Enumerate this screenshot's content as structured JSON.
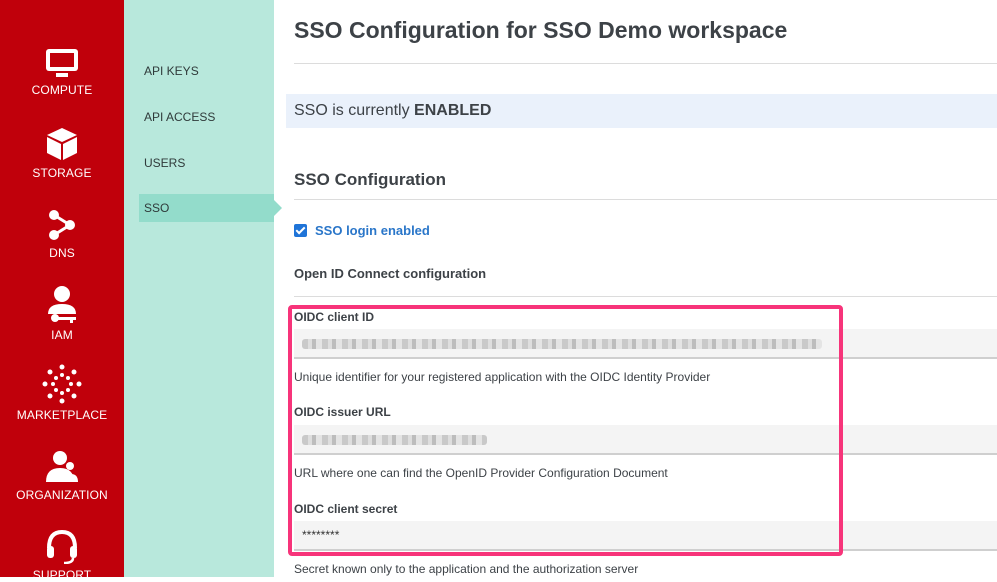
{
  "nav": {
    "items": [
      {
        "label": "COMPUTE",
        "icon": "monitor-icon"
      },
      {
        "label": "STORAGE",
        "icon": "cube-icon"
      },
      {
        "label": "DNS",
        "icon": "network-icon"
      },
      {
        "label": "IAM",
        "icon": "user-key-icon"
      },
      {
        "label": "MARKETPLACE",
        "icon": "marketplace-dots-icon"
      },
      {
        "label": "ORGANIZATION",
        "icon": "users-icon"
      },
      {
        "label": "SUPPORT",
        "icon": "headset-icon"
      }
    ]
  },
  "subnav": {
    "items": [
      {
        "label": "API KEYS"
      },
      {
        "label": "API ACCESS"
      },
      {
        "label": "USERS"
      },
      {
        "label": "SSO",
        "active": true
      }
    ]
  },
  "main": {
    "title": "SSO Configuration for SSO Demo workspace",
    "status_prefix": "SSO is currently",
    "status_value": "ENABLED",
    "section_title": "SSO Configuration",
    "sso_login_enabled_label": "SSO login enabled",
    "oidc_heading": "Open ID Connect configuration",
    "fields": {
      "client_id": {
        "label": "OIDC client ID",
        "help": "Unique identifier for your registered application with the OIDC Identity Provider"
      },
      "issuer_url": {
        "label": "OIDC issuer URL",
        "help": "URL where one can find the OpenID Provider Configuration Document"
      },
      "client_secret": {
        "label": "OIDC client secret",
        "value": "********",
        "help": "Secret known only to the application and the authorization server"
      }
    }
  },
  "colors": {
    "nav_bg": "#c0000b",
    "subnav_bg": "#b8e8dc",
    "subnav_active": "#93dccb",
    "highlight_border": "#f7347a",
    "link_blue": "#2a76c9"
  }
}
